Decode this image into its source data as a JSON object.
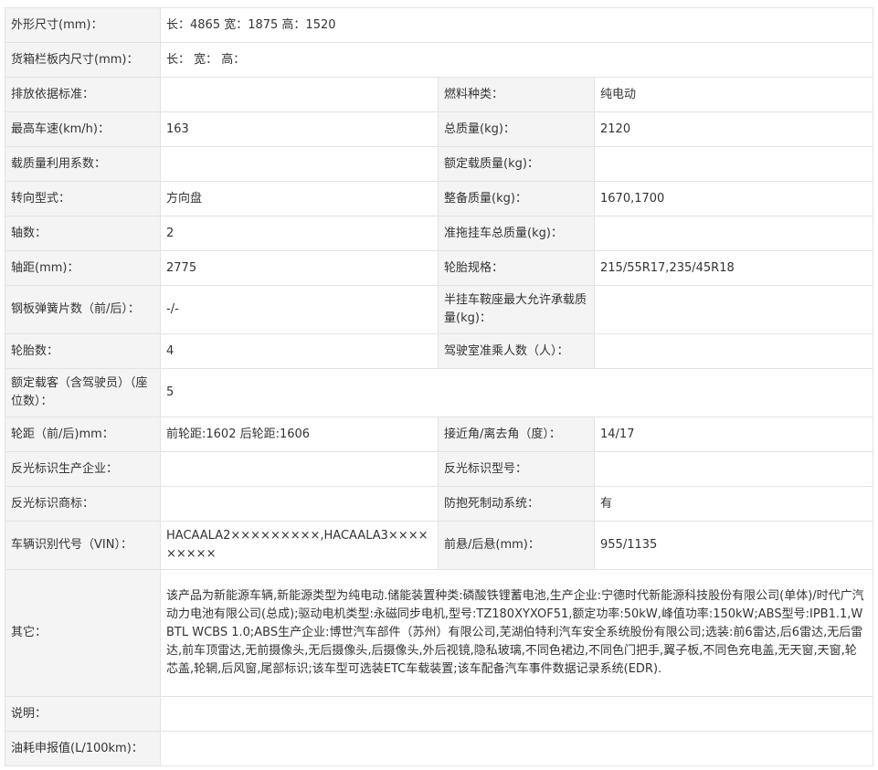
{
  "rows": [
    {
      "l1": "外形尺寸(mm)：",
      "v1": "长：4865 宽：1875 高：1520"
    },
    {
      "l1": "货箱栏板内尺寸(mm)：",
      "v1": "长： 宽： 高："
    },
    {
      "l1": "排放依据标准：",
      "v1": "",
      "l2": "燃料种类：",
      "v2": "纯电动"
    },
    {
      "l1": "最高车速(km/h)：",
      "v1": "163",
      "l2": "总质量(kg)：",
      "v2": "2120"
    },
    {
      "l1": "载质量利用系数：",
      "v1": "",
      "l2": "额定载质量(kg)：",
      "v2": ""
    },
    {
      "l1": "转向型式：",
      "v1": "方向盘",
      "l2": "整备质量(kg)：",
      "v2": "1670,1700"
    },
    {
      "l1": "轴数：",
      "v1": "2",
      "l2": "准拖挂车总质量(kg)：",
      "v2": ""
    },
    {
      "l1": "轴距(mm)：",
      "v1": "2775",
      "l2": "轮胎规格：",
      "v2": "215/55R17,235/45R18"
    },
    {
      "l1": "钢板弹簧片数（前/后）：",
      "v1": "-/-",
      "l2": "半挂车鞍座最大允许承载质量(kg)：",
      "v2": ""
    },
    {
      "l1": "轮胎数：",
      "v1": "4",
      "l2": "驾驶室准乘人数（人）：",
      "v2": ""
    },
    {
      "l1": "额定载客（含驾驶员）（座位数）：",
      "v1": "5"
    },
    {
      "l1": "轮距（前/后)mm：",
      "v1": "前轮距:1602 后轮距:1606",
      "l2": "接近角/离去角（度）：",
      "v2": "14/17"
    },
    {
      "l1": "反光标识生产企业：",
      "v1": "",
      "l2": "反光标识型号：",
      "v2": ""
    },
    {
      "l1": "反光标识商标：",
      "v1": "",
      "l2": "防抱死制动系统：",
      "v2": "有"
    },
    {
      "l1": "车辆识别代号（VIN）：",
      "v1": "HACAALA2×××××××××,HACAALA3×××××××××",
      "l2": "前悬/后悬(mm)：",
      "v2": "955/1135"
    },
    {
      "l1": "其它：",
      "v1": "该产品为新能源车辆,新能源类型为纯电动.储能装置种类:磷酸铁锂蓄电池,生产企业:宁德时代新能源科技股份有限公司(单体)/时代广汽动力电池有限公司(总成);驱动电机类型:永磁同步电机,型号:TZ180XYXOF51,额定功率:50kW,峰值功率:150kW;ABS型号:IPB1.1,WBTL WCBS 1.0;ABS生产企业:博世汽车部件（苏州）有限公司,芜湖伯特利汽车安全系统股份有限公司;选装:前6雷达,后6雷达,无后雷达,前车顶雷达,无前摄像头,无后摄像头,后摄像头,外后视镜,隐私玻璃,不同色裙边,不同色门把手,翼子板,不同色充电盖,无天窗,天窗,轮芯盖,轮辋,后风窗,尾部标识;该车型可选装ETC车载装置;该车配备汽车事件数据记录系统(EDR)."
    },
    {
      "l1": "说明：",
      "v1": ""
    },
    {
      "l1": "油耗申报值(L/100km)：",
      "v1": ""
    }
  ]
}
